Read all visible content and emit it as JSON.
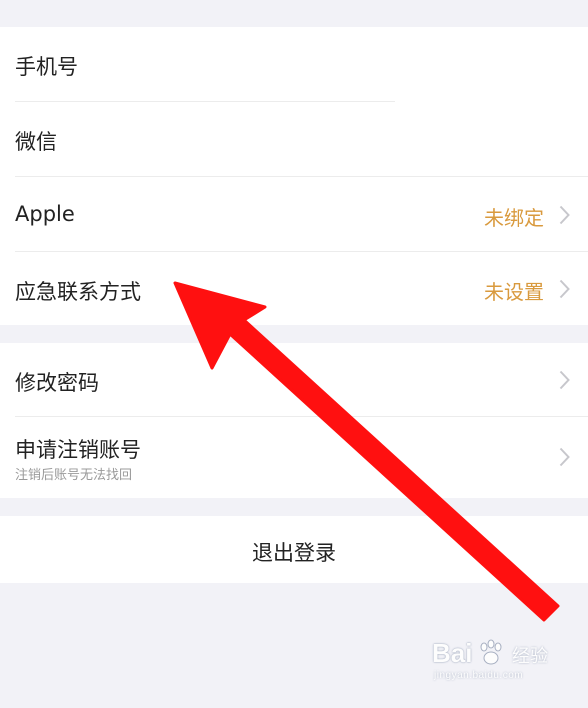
{
  "account_bindings": {
    "items": [
      {
        "label": "手机号",
        "value": ""
      },
      {
        "label": "微信",
        "value": ""
      },
      {
        "label": "Apple",
        "value": "未绑定"
      },
      {
        "label": "应急联系方式",
        "value": "未设置"
      }
    ]
  },
  "security": {
    "change_password": "修改密码",
    "deactivate_title": "申请注销账号",
    "deactivate_subtitle": "注销后账号无法找回"
  },
  "logout": {
    "label": "退出登录"
  },
  "watermark": {
    "brand": "Bai",
    "brand_cn": "经验",
    "url": "jingyan.baidu.com"
  },
  "colors": {
    "background": "#f2f2f7",
    "row": "#ffffff",
    "value_text": "#d99a3e",
    "annotation_arrow": "#ff1010"
  },
  "icons": {
    "row_chevron": "chevron-right-icon",
    "annotation": "red-arrow-icon"
  }
}
